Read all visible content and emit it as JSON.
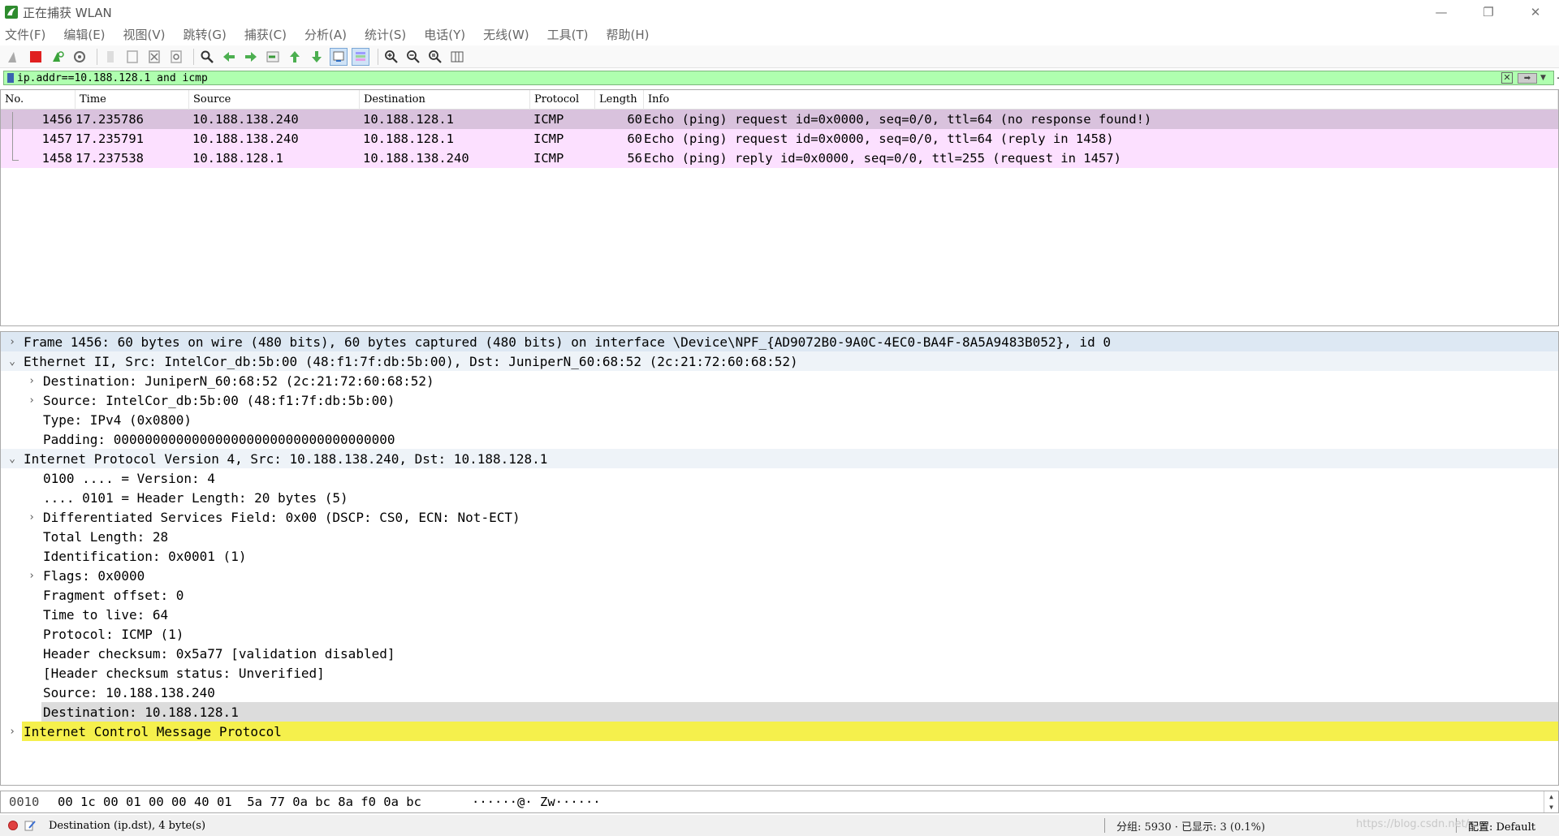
{
  "window": {
    "title": "正在捕获 WLAN",
    "minimize": "—",
    "restore": "❐",
    "close": "✕"
  },
  "menu": [
    "文件(F)",
    "编辑(E)",
    "视图(V)",
    "跳转(G)",
    "捕获(C)",
    "分析(A)",
    "统计(S)",
    "电话(Y)",
    "无线(W)",
    "工具(T)",
    "帮助(H)"
  ],
  "toolbar": {
    "icons": [
      "shark-fin-start-icon",
      "stop-capture-icon",
      "restart-capture-icon",
      "capture-options-icon",
      "open-file-icon",
      "save-file-icon",
      "close-file-icon",
      "reload-file-icon",
      "find-packet-icon",
      "go-back-icon",
      "go-forward-icon",
      "go-to-packet-icon",
      "go-first-icon",
      "go-last-icon",
      "auto-scroll-icon",
      "colorize-icon",
      "zoom-in-icon",
      "zoom-out-icon",
      "zoom-normal-icon",
      "resize-columns-icon"
    ]
  },
  "filter": {
    "value": "ip.addr==10.188.128.1 and icmp",
    "colors": {
      "valid_bg": "#afffaf"
    }
  },
  "packet_list": {
    "columns": [
      "No.",
      "Time",
      "Source",
      "Destination",
      "Protocol",
      "Length",
      "Info"
    ],
    "rows": [
      {
        "no": "1456",
        "time": "17.235786",
        "src": "10.188.138.240",
        "dst": "10.188.128.1",
        "proto": "ICMP",
        "len": "60",
        "info": "Echo (ping) request  id=0x0000, seq=0/0, ttl=64 (no response found!)"
      },
      {
        "no": "1457",
        "time": "17.235791",
        "src": "10.188.138.240",
        "dst": "10.188.128.1",
        "proto": "ICMP",
        "len": "60",
        "info": "Echo (ping) request  id=0x0000, seq=0/0, ttl=64 (reply in 1458)"
      },
      {
        "no": "1458",
        "time": "17.237538",
        "src": "10.188.128.1",
        "dst": "10.188.138.240",
        "proto": "ICMP",
        "len": "56",
        "info": "Echo (ping) reply    id=0x0000, seq=0/0, ttl=255 (request in 1457)"
      }
    ],
    "colors": {
      "selected": "#d9c2dd",
      "icmp_row": "#fce0ff"
    }
  },
  "details": {
    "frame": "Frame 1456: 60 bytes on wire (480 bits), 60 bytes captured (480 bits) on interface \\Device\\NPF_{AD9072B0-9A0C-4EC0-BA4F-8A5A9483B052}, id 0",
    "ethernet": "Ethernet II, Src: IntelCor_db:5b:00 (48:f1:7f:db:5b:00), Dst: JuniperN_60:68:52 (2c:21:72:60:68:52)",
    "eth_dst": "Destination: JuniperN_60:68:52 (2c:21:72:60:68:52)",
    "eth_src": "Source: IntelCor_db:5b:00 (48:f1:7f:db:5b:00)",
    "eth_type": "Type: IPv4 (0x0800)",
    "eth_padding": "Padding: 000000000000000000000000000000000000",
    "ip": "Internet Protocol Version 4, Src: 10.188.138.240, Dst: 10.188.128.1",
    "ip_version": "0100 .... = Version: 4",
    "ip_hlen": ".... 0101 = Header Length: 20 bytes (5)",
    "ip_dsf": "Differentiated Services Field: 0x00 (DSCP: CS0, ECN: Not-ECT)",
    "ip_totlen": "Total Length: 28",
    "ip_id": "Identification: 0x0001 (1)",
    "ip_flags": "Flags: 0x0000",
    "ip_frag": "Fragment offset: 0",
    "ip_ttl": "Time to live: 64",
    "ip_proto": "Protocol: ICMP (1)",
    "ip_cksum": "Header checksum: 0x5a77 [validation disabled]",
    "ip_cksum_status": "[Header checksum status: Unverified]",
    "ip_src": "Source: 10.188.138.240",
    "ip_dst": "Destination: 10.188.128.1",
    "icmp": "Internet Control Message Protocol",
    "colors": {
      "highlight_yellow": "#f5f04c",
      "selected_field": "#dcdcdc"
    }
  },
  "bytes": {
    "offset": "0010",
    "hex": "00 1c 00 01 00 00 40 01  5a 77 0a bc 8a f0 0a bc",
    "ascii": "······@· Zw······"
  },
  "status": {
    "field_info": "Destination (ip.dst), 4 byte(s)",
    "stats": "分组: 5930 · 已显示: 3 (0.1%)",
    "profile": "配置: Default",
    "watermark": "https://blog.csdn.net/..."
  }
}
